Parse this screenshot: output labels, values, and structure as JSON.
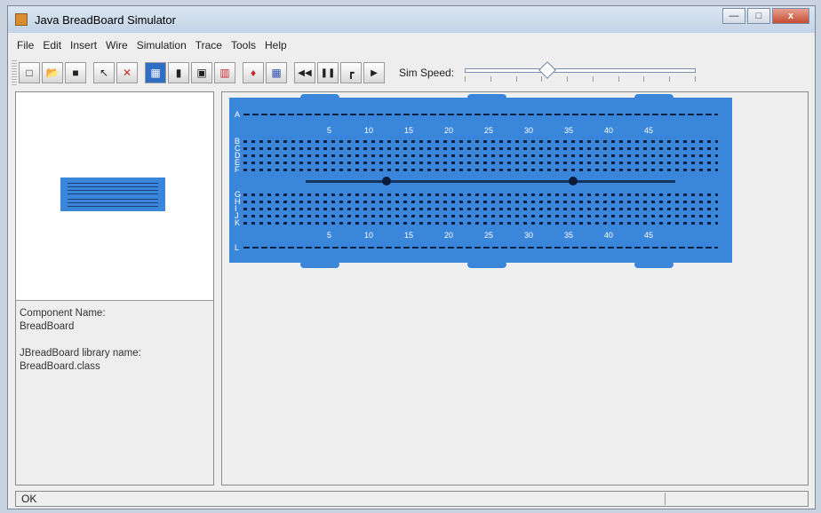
{
  "window": {
    "title": "Java BreadBoard Simulator",
    "controls": {
      "minimize": "—",
      "maximize": "□",
      "close": "x"
    }
  },
  "menu": [
    "File",
    "Edit",
    "Insert",
    "Wire",
    "Simulation",
    "Trace",
    "Tools",
    "Help"
  ],
  "toolbar": {
    "speed_label": "Sim Speed:",
    "speed_value_fraction": 0.34,
    "buttons": {
      "new": "□",
      "open": "📂",
      "save": "■",
      "select": "↖",
      "delete": "✕",
      "board": "▦",
      "chip": "▮",
      "chip2": "▣",
      "resistor": "▥",
      "probe": "♦",
      "led": "▦",
      "rewind": "◀◀",
      "pause": "❚❚",
      "step": "┏",
      "play": "▶"
    }
  },
  "left_panel": {
    "component_name_label": "Component Name:",
    "component_name": "BreadBoard",
    "library_label": "JBreadBoard library name:",
    "library_name": "BreadBoard.class"
  },
  "board": {
    "column_numbers": [
      "5",
      "10",
      "15",
      "20",
      "25",
      "30",
      "35",
      "40",
      "45"
    ],
    "rail_letter": "A",
    "bottom_rail_letter": "L",
    "top_letters": [
      "B",
      "C",
      "D",
      "E",
      "F"
    ],
    "bottom_letters": [
      "G",
      "H",
      "I",
      "J",
      "K"
    ]
  },
  "status": {
    "text": "OK"
  },
  "colors": {
    "board": "#3a86db",
    "holes": "#0a2244"
  }
}
